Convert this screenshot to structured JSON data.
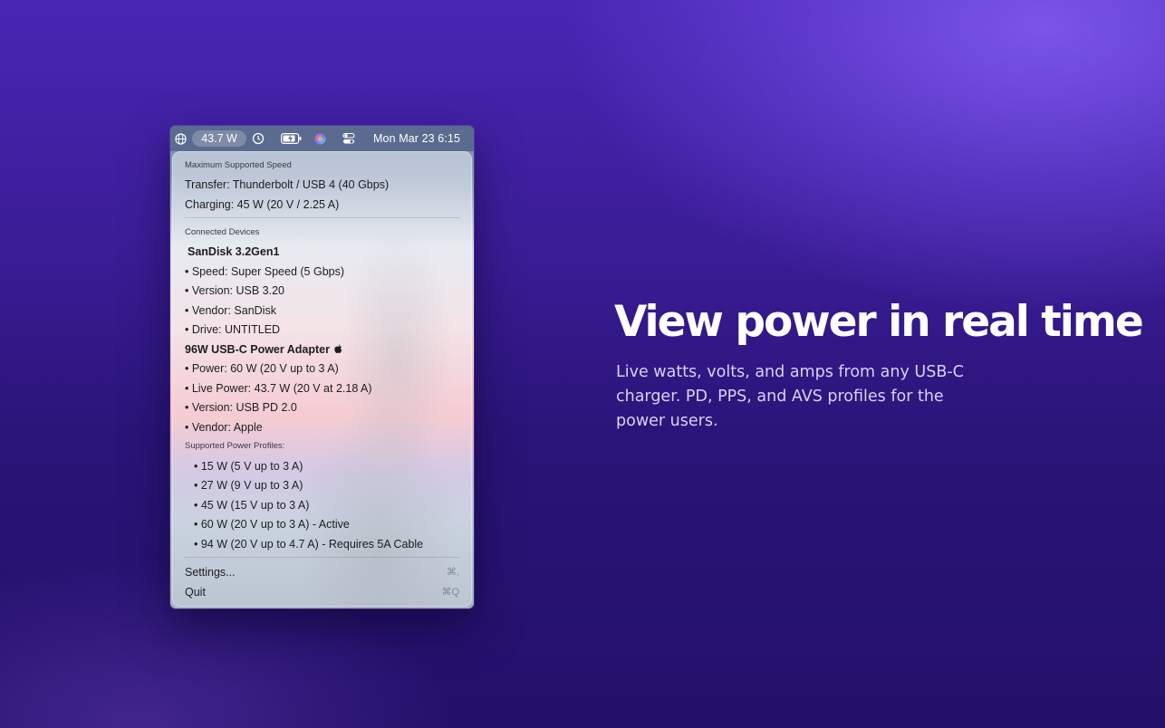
{
  "menubar": {
    "watts": "43.7 W",
    "datetime": "Mon Mar 23  6:15",
    "icons": [
      "globe-icon",
      "history-icon",
      "battery-icon",
      "siri-icon",
      "control-center-icon"
    ]
  },
  "menu": {
    "max_speed_header": "Maximum Supported Speed",
    "transfer": "Transfer: Thunderbolt / USB 4 (40 Gbps)",
    "charging": "Charging: 45 W (20 V / 2.25 A)",
    "connected_header": "Connected Devices",
    "sandisk": {
      "name": "SanDisk 3.2Gen1",
      "speed": "• Speed: Super Speed (5 Gbps)",
      "version": "• Version: USB 3.20",
      "vendor": "• Vendor: SanDisk",
      "drive": "• Drive: UNTITLED"
    },
    "adapter": {
      "name": "96W USB-C Power Adapter",
      "power": "• Power: 60 W (20 V up to 3 A)",
      "live_power": "• Live Power: 43.7 W (20 V at 2.18 A)",
      "version": "• Version: USB PD 2.0",
      "vendor": "• Vendor: Apple"
    },
    "profiles_header": "Supported Power Profiles:",
    "profiles": [
      "• 15 W (5 V up to 3 A)",
      "• 27 W (9 V up to 3 A)",
      "• 45 W (15 V up to 3 A)",
      "• 60 W (20 V up to 3 A) - Active",
      "• 94 W (20 V up to 4.7 A) - Requires 5A Cable"
    ],
    "settings_label": "Settings...",
    "settings_shortcut": "⌘,",
    "quit_label": "Quit",
    "quit_shortcut": "⌘Q"
  },
  "headline": "View power in real time",
  "subtext": "Live watts, volts, and amps from any USB-C charger. PD, PPS, and AVS profiles for the power users.",
  "colors": {
    "background_top": "#4a26b4",
    "background_bottom": "#24106a",
    "accent_glow": "#7b55ea",
    "headline": "#ffffff",
    "subtext": "#d9d2f5"
  }
}
